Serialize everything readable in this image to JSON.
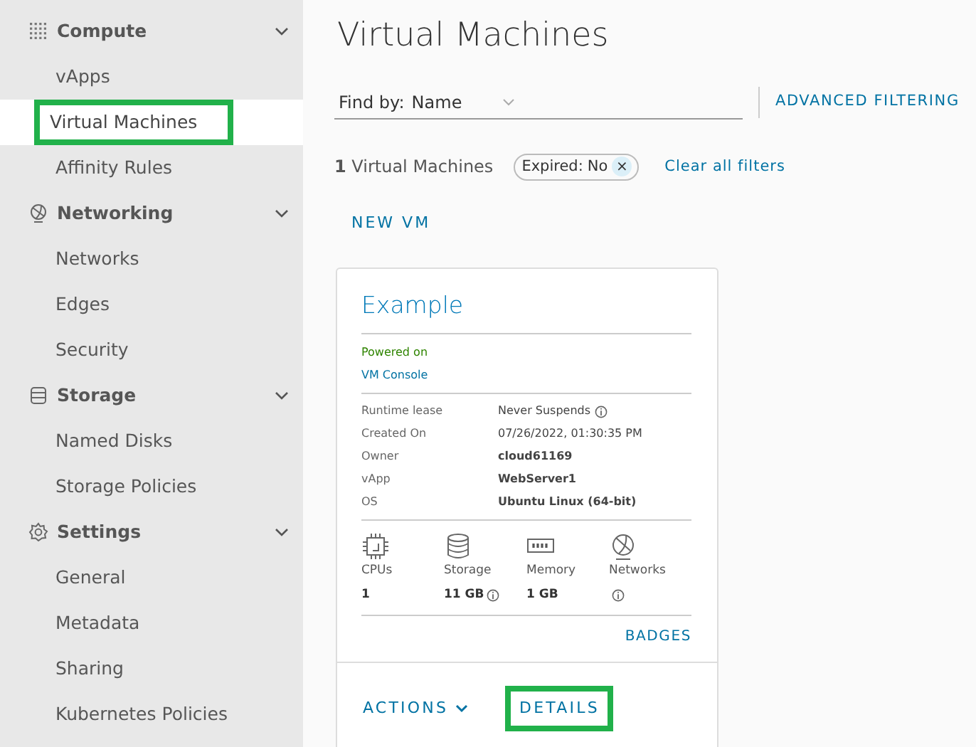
{
  "sidebar": {
    "groups": [
      {
        "label": "Compute",
        "expanded": true,
        "items": [
          {
            "label": "vApps",
            "selected": false,
            "highlighted": false
          },
          {
            "label": "Virtual Machines",
            "selected": true,
            "highlighted": true
          },
          {
            "label": "Affinity Rules",
            "selected": false,
            "highlighted": false
          }
        ]
      },
      {
        "label": "Networking",
        "expanded": true,
        "items": [
          {
            "label": "Networks",
            "selected": false,
            "highlighted": false
          },
          {
            "label": "Edges",
            "selected": false,
            "highlighted": false
          },
          {
            "label": "Security",
            "selected": false,
            "highlighted": false
          }
        ]
      },
      {
        "label": "Storage",
        "expanded": true,
        "items": [
          {
            "label": "Named Disks",
            "selected": false,
            "highlighted": false
          },
          {
            "label": "Storage Policies",
            "selected": false,
            "highlighted": false
          }
        ]
      },
      {
        "label": "Settings",
        "expanded": true,
        "items": [
          {
            "label": "General",
            "selected": false,
            "highlighted": false
          },
          {
            "label": "Metadata",
            "selected": false,
            "highlighted": false
          },
          {
            "label": "Sharing",
            "selected": false,
            "highlighted": false
          },
          {
            "label": "Kubernetes Policies",
            "selected": false,
            "highlighted": false
          }
        ]
      }
    ]
  },
  "main": {
    "title": "Virtual Machines",
    "find_by": {
      "label": "Find by:",
      "value": "Name"
    },
    "advanced_filtering": "ADVANCED FILTERING",
    "count": "**1** Virtual Machines",
    "filter_chip": {
      "key": "Expired:",
      "value": "No",
      "close": "×"
    },
    "clear_filters": "Clear all filters",
    "new_vm": "NEW VM",
    "card": {
      "name": "Example",
      "status": "Powered on",
      "console": "VM Console",
      "details": [
        {
          "label": "Runtime lease",
          "value": "Never Suspends",
          "bold": false,
          "info": true
        },
        {
          "label": "Created On",
          "value": "07/26/2022, 01:30:35 PM",
          "bold": false,
          "info": false
        },
        {
          "label": "Owner",
          "value": "cloud61169",
          "bold": true,
          "info": false
        },
        {
          "label": "vApp",
          "value": "WebServer1",
          "bold": true,
          "info": false
        },
        {
          "label": "OS",
          "value": "Ubuntu Linux (64-bit)",
          "bold": true,
          "info": false
        }
      ],
      "resources": [
        {
          "label": "CPUs",
          "value": "1",
          "info": false
        },
        {
          "label": "Storage",
          "value": "11 GB",
          "info": true
        },
        {
          "label": "Memory",
          "value": "1 GB",
          "info": false
        },
        {
          "label": "Networks",
          "info": true
        }
      ],
      "badges": "BADGES",
      "actions": "ACTIONS",
      "details_button": {
        "label": "DETAILS",
        "highlighted": true
      }
    }
  }
}
